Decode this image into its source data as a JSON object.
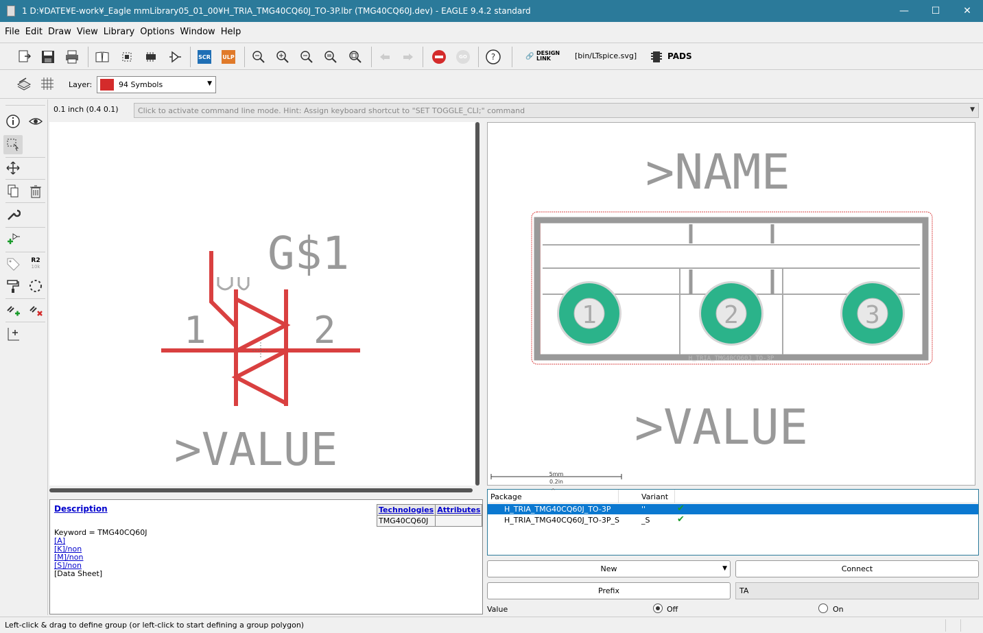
{
  "window": {
    "title": "1 D:¥DATE¥E-work¥_Eagle mmLibrary05_01_00¥H_TRIA_TMG40CQ60J_TO-3P.lbr (TMG40CQ60J.dev) - EAGLE 9.4.2 standard",
    "minimize": "—",
    "maximize": "☐",
    "close": "✕"
  },
  "menu": [
    "File",
    "Edit",
    "Draw",
    "View",
    "Library",
    "Options",
    "Window",
    "Help"
  ],
  "toolbar": {
    "scr_label": "SCR",
    "ulp_label": "ULP",
    "go_label": "GO",
    "design_link_label": "DESIGN LINK",
    "ulp_path": "[bin/LTspice.svg]",
    "pads_label": "PADS"
  },
  "layer": {
    "label": "Layer:",
    "selected": "94 Symbols",
    "color": "#d42b2b"
  },
  "palette": {
    "r2_label": "R2",
    "r2_sub": "10k"
  },
  "command": {
    "coordinate": "0.1 inch (0.4 0.1)",
    "placeholder": "Click to activate command line mode. Hint: Assign keyboard shortcut to \"SET TOGGLE_CLI;\" command"
  },
  "symbol": {
    "name_label": "G$1",
    "value_label": ">VALUE",
    "pin1": "1",
    "pin2": "2"
  },
  "package_view": {
    "name_label": ">NAME",
    "value_label": ">VALUE",
    "pads": [
      "1",
      "2",
      "3"
    ],
    "silkscreen_text": "H_TRIA_TMG40CQ60J_TO-3P",
    "scale_mm": "5mm",
    "scale_in": "0.2in"
  },
  "description": {
    "title": "Description",
    "keyword": "Keyword = TMG40CQ60J",
    "links": [
      "[A]",
      "[K]",
      "[M]",
      "[S]"
    ],
    "link_suffixes": [
      "",
      "/non",
      "/non",
      "/non"
    ],
    "datasheet": "[Data Sheet]",
    "tech_headers": [
      "Technologies",
      "Attributes"
    ],
    "tech_values": [
      "TMG40CQ60J",
      ""
    ]
  },
  "packages": {
    "col_package": "Package",
    "col_variant": "Variant",
    "rows": [
      {
        "package": "H_TRIA_TMG40CQ60J_TO-3P",
        "variant": "''",
        "check": "✔",
        "selected": true
      },
      {
        "package": "H_TRIA_TMG40CQ60J_TO-3P_S",
        "variant": "_S",
        "check": "✔",
        "selected": false
      }
    ]
  },
  "controls": {
    "new_label": "New",
    "connect_label": "Connect",
    "prefix_label": "Prefix",
    "prefix_value": "TA",
    "value_label": "Value",
    "off_label": "Off",
    "on_label": "On"
  },
  "status": {
    "message": "Left-click & drag to define group (or left-click to start defining a group polygon)"
  }
}
